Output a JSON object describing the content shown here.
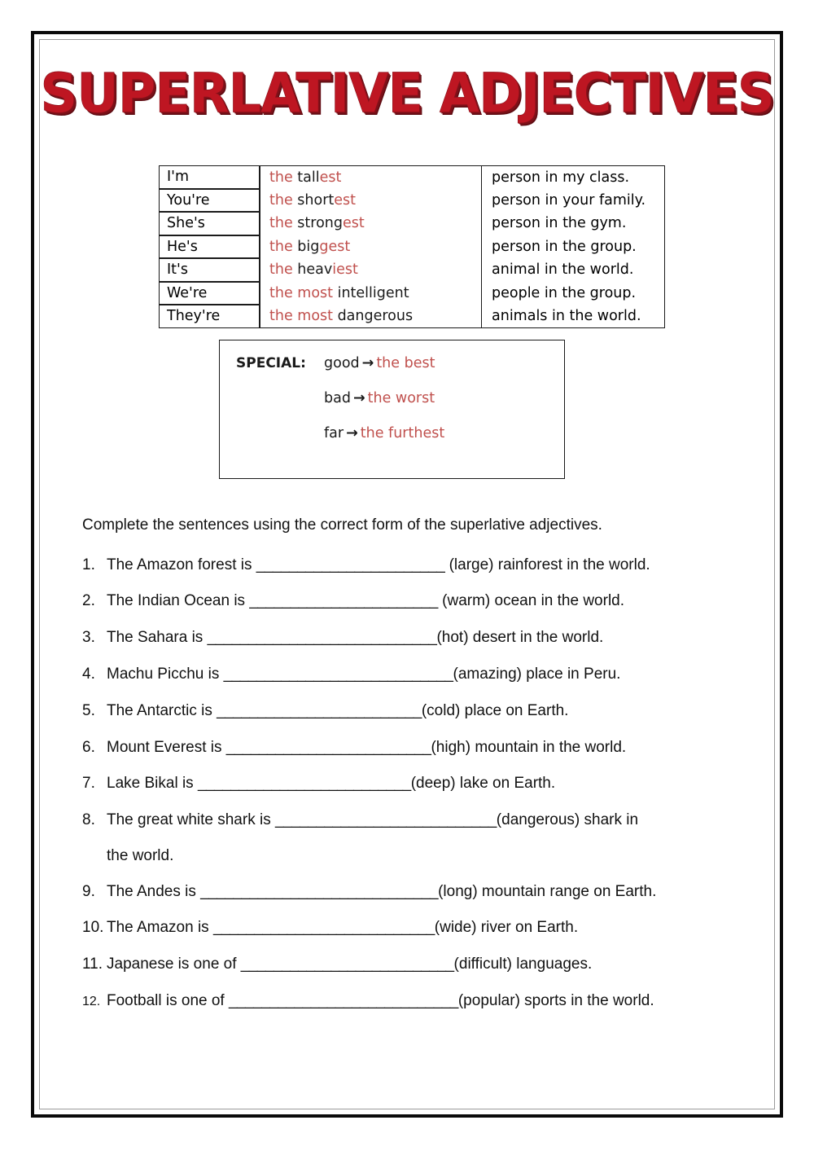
{
  "title": "SUPERLATIVE ADJECTIVES",
  "title_color": "#BE1622",
  "accent_red": "#C0504D",
  "grammar_table": {
    "rows": [
      {
        "subject": "I'm",
        "the": "the ",
        "adj_black": "tall",
        "adj_red": "est",
        "object": "person in my class."
      },
      {
        "subject": "You're",
        "the": "the ",
        "adj_black": "short",
        "adj_red": "est",
        "object": "person in your family."
      },
      {
        "subject": "She's",
        "the": "the ",
        "adj_black": "strong",
        "adj_red": "est",
        "object": "person in the gym."
      },
      {
        "subject": "He's",
        "the": "the ",
        "adj_black": "big",
        "adj_red": "gest",
        "object": "person in the group."
      },
      {
        "subject": "It's",
        "the": "the ",
        "adj_black": "heav",
        "adj_red": "iest",
        "object": "animal in the world."
      },
      {
        "subject": "We're",
        "the": "the most ",
        "adj_black": "intelligent",
        "adj_red": "",
        "object": "people in the group."
      },
      {
        "subject": "They're",
        "the": "the most ",
        "adj_black": " dangerous",
        "adj_red": "",
        "object": "animals in the world."
      }
    ]
  },
  "special": {
    "label": "SPECIAL:",
    "rows": [
      {
        "base": "good",
        "arrow": "→",
        "superlative": "the best"
      },
      {
        "base": "bad",
        "arrow": "→",
        "superlative": "the worst"
      },
      {
        "base": "far",
        "arrow": "→",
        "superlative": "the furthest"
      }
    ]
  },
  "exercise": {
    "instructions": "Complete the sentences using the correct form of the superlative adjectives.",
    "blank": "_______________________",
    "blank_long": "_____________________________",
    "questions": [
      {
        "num": "1.",
        "before": "The Amazon forest is ",
        "blank": "_______________________",
        "after": " (large) rainforest in the world."
      },
      {
        "num": "2.",
        "before": "The Indian Ocean is ",
        "blank": "_______________________",
        "after": " (warm) ocean in the world."
      },
      {
        "num": "3.",
        "before": "The Sahara is ",
        "blank": "____________________________",
        "after": "(hot) desert in the world."
      },
      {
        "num": "4.",
        "before": "Machu Picchu is ",
        "blank": "____________________________",
        "after": "(amazing) place in Peru."
      },
      {
        "num": "5.",
        "before": "The Antarctic is ",
        "blank": "_________________________",
        "after": "(cold) place on Earth."
      },
      {
        "num": "6.",
        "before": "Mount Everest is ",
        "blank": "_________________________",
        "after": "(high) mountain in the world."
      },
      {
        "num": "7.",
        "before": "Lake Bikal is ",
        "blank": "__________________________",
        "after": "(deep) lake on Earth."
      },
      {
        "num": "8.",
        "before": "The great white shark is ",
        "blank": "___________________________",
        "after": "(dangerous) shark in",
        "continuation": "the world."
      },
      {
        "num": "9.",
        "before": "The Andes is ",
        "blank": "_____________________________",
        "after": "(long) mountain range on Earth."
      },
      {
        "num": "10.",
        "before": "The Amazon is ",
        "blank": "___________________________",
        "after": "(wide) river on Earth."
      },
      {
        "num": "11.",
        "before": "Japanese is one of ",
        "blank": "__________________________",
        "after": "(difficult) languages."
      },
      {
        "num": "12.",
        "before": "Football is one of ",
        "blank": "____________________________",
        "after": "(popular) sports in the world."
      }
    ]
  }
}
